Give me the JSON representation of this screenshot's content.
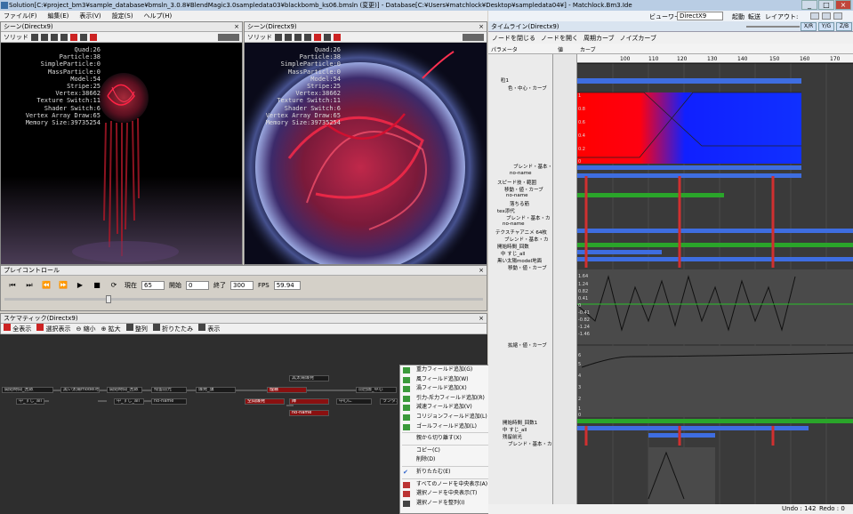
{
  "title_bar": {
    "text": "Solution[C:¥project_bm3¥sample_database¥bmsln_3.0.8¥BlendMagic3.0sampledata03¥blackbomb_ks06.bmsln (変更)]  -  Database[C:¥Users¥matchlock¥Desktop¥sampledata04¥]  -  Matchlock.Bm3.Ide"
  },
  "menu": [
    "ファイル(F)",
    "編集(E)",
    "表示(V)",
    "設定(S)",
    "ヘルプ(H)"
  ],
  "viewer": {
    "label": "ビューワー:",
    "renderer": "DirectX9",
    "start": "起動",
    "transfer": "転送",
    "layout": "レイアウト:"
  },
  "scene_left": {
    "title": "シーン(Directx9)",
    "mode": "ソリッド"
  },
  "scene_right": {
    "title": "シーン(Directx9)",
    "mode": "ソリッド"
  },
  "stats": "Quad:26\nParticle:38\nSimpleParticle:0\nMassParticle:0\nModel:54\nStripe:25\nVertex:38662\nTexture Switch:11\nShader Switch:6\nVertex Array Draw:65\nMemory Size:39735254",
  "play": {
    "title": "プレイコントロール",
    "current_label": "現在",
    "current": "65",
    "start_label": "開始",
    "start": "0",
    "end_label": "終了",
    "end": "300",
    "fps_label": "FPS",
    "fps": "59.94"
  },
  "schematic": {
    "title": "スケマティック(Directx9)",
    "tools": [
      "全表示",
      "選択表示",
      "縮小",
      "拡大",
      "整列",
      "折りたたみ",
      "表示"
    ]
  },
  "nodes": [
    "開始時間_回数",
    "黒い太陽model地面",
    "開始時間_回数",
    "残留前光",
    "爆発_旗",
    "黒太陽爆発",
    "煙霧",
    "前回層_中心",
    "中_すじ_all",
    "中_すじ_all",
    "no-name",
    "no-name",
    "中心に",
    "ランダム",
    "空間爆発",
    "陣"
  ],
  "context_menu": [
    "重力フィールド追加(G)",
    "風フィールド追加(W)",
    "渦フィールド追加(X)",
    "引力-斥力フィールド追加(R)",
    "減速フィールド追加(V)",
    "コリジョンフィールド追加(L)",
    "ゴールフィールド追加(L)",
    "親から切り離す(X)",
    "コピー(C)",
    "削除(D)",
    "折りたたむ(E)",
    "すべてのノードを中央表示(A)",
    "選択ノードを中央表示(T)",
    "選択ノードを整列(I)"
  ],
  "timeline": {
    "title": "タイムライン(Directx9)",
    "tools": [
      "ノードを閉じる",
      "ノードを開く",
      "周期カーブ",
      "ノイズカーブ"
    ],
    "param_header": "パラメータ",
    "value_header": "値",
    "curve_header": "カーブ",
    "xr": "X/R",
    "yg": "Y/G",
    "zb": "Z/B",
    "ticks": [
      "100",
      "110",
      "120",
      "130",
      "140",
      "150",
      "160",
      "170"
    ]
  },
  "params": [
    "粒1",
    "色・中心・カーブ",
    "ブレンド・基本・",
    "no-name",
    "スピード技・範囲",
    "移動・値・カーブ",
    "no-name",
    "落ちる筋",
    "tex添代",
    "ブレンド・基本・カ",
    "no-name",
    "テクスチャアニメ 64枚",
    "ブレンド・基本・カ",
    "開始時間_回数",
    "中 すじ_all",
    "黒い太陽model地面",
    "移動・値・カーブ",
    "拡縮・値・カーブ",
    "開始時間_回数1",
    "中 すじ_all",
    "残留前光",
    "ブレンド・基本・カーブ"
  ],
  "graph_labels": [
    "1",
    "0.8",
    "0.6",
    "0.4",
    "0.2",
    "0",
    "1.64",
    "1.24",
    "0.82",
    "0.41",
    "0",
    "-0.41",
    "-0.82",
    "-1.24",
    "-1.46",
    "6",
    "5",
    "4",
    "3",
    "2",
    "1",
    "0"
  ],
  "status": {
    "undo": "Undo : 142",
    "redo": "Redo : 0"
  }
}
